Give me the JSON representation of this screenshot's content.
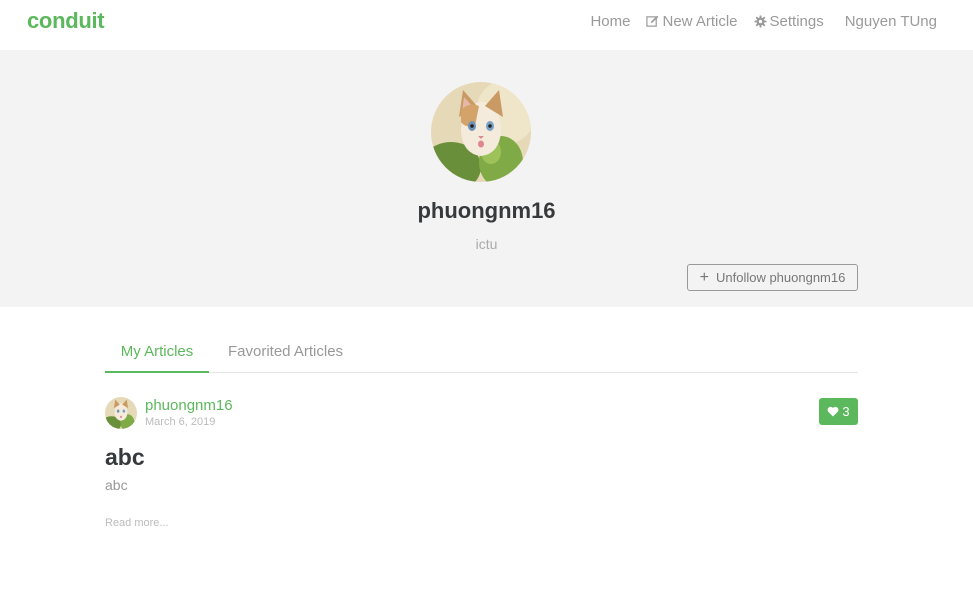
{
  "navbar": {
    "brand": "conduit",
    "items": [
      {
        "label": "Home",
        "icon": ""
      },
      {
        "label": "New Article",
        "icon": "edit-icon"
      },
      {
        "label": "Settings",
        "icon": "gear-icon"
      },
      {
        "label": "Nguyen TUng",
        "icon": ""
      }
    ]
  },
  "profile": {
    "username": "phuongnm16",
    "bio": "ictu",
    "follow_button": "Unfollow phuongnm16",
    "avatar_icon": "cat-avatar"
  },
  "tabs": [
    {
      "label": "My Articles",
      "active": true
    },
    {
      "label": "Favorited Articles",
      "active": false
    }
  ],
  "articles": [
    {
      "author": "phuongnm16",
      "date": "March 6, 2019",
      "favorites": "3",
      "title": "abc",
      "description": "abc",
      "read_more": "Read more..."
    }
  ],
  "colors": {
    "brand": "#5cb85c",
    "banner": "#f3f3f3",
    "muted": "#999999"
  }
}
